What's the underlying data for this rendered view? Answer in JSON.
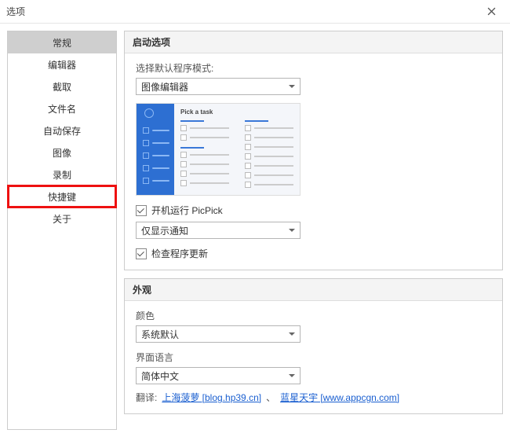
{
  "window": {
    "title": "选项"
  },
  "sidebar": {
    "items": [
      {
        "label": "常规"
      },
      {
        "label": "编辑器"
      },
      {
        "label": "截取"
      },
      {
        "label": "文件名"
      },
      {
        "label": "自动保存"
      },
      {
        "label": "图像"
      },
      {
        "label": "录制"
      },
      {
        "label": "快捷键"
      },
      {
        "label": "关于"
      }
    ]
  },
  "startup": {
    "header": "启动选项",
    "mode_label": "选择默认程序模式:",
    "mode_value": "图像编辑器",
    "preview_title": "Pick a task",
    "run_on_boot_label": "开机运行 PicPick",
    "run_on_boot_checked": true,
    "notify_select_value": "仅显示通知",
    "check_update_label": "检查程序更新",
    "check_update_checked": true
  },
  "appearance": {
    "header": "外观",
    "color_label": "颜色",
    "color_value": "系统默认",
    "lang_label": "界面语言",
    "lang_value": "简体中文",
    "translate_label": "翻译:",
    "translator1": "上海菠萝 [blog.hp39.cn]",
    "sep": "、",
    "translator2": "蓝星天宇 [www.appcgn.com]"
  }
}
